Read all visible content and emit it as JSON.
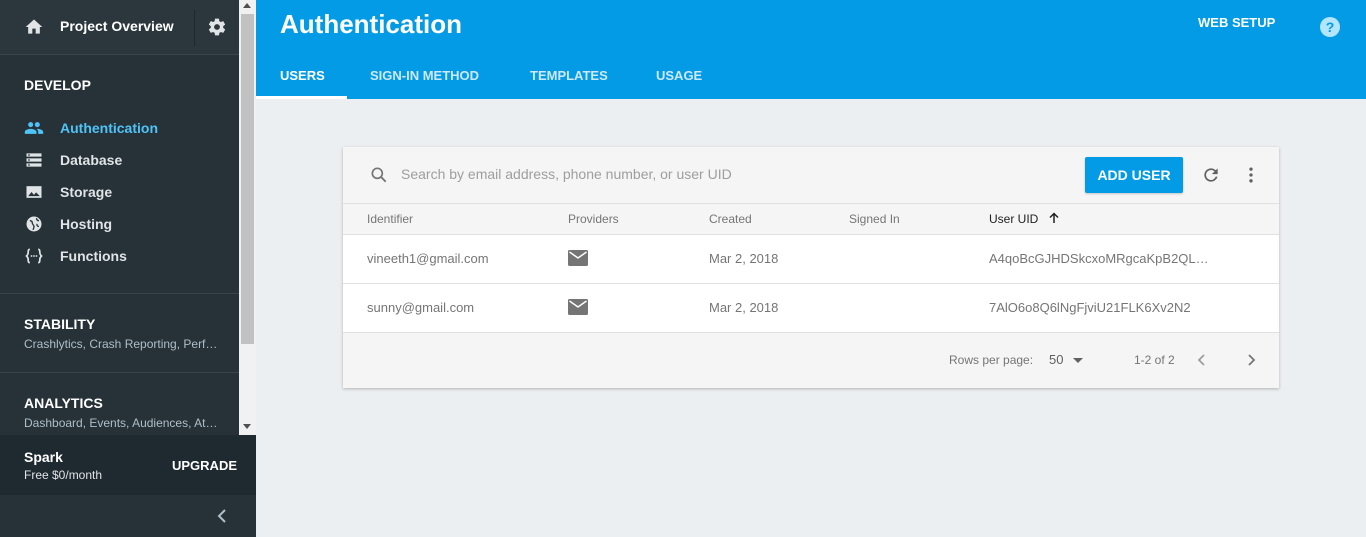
{
  "sidebar": {
    "project_title": "Project Overview",
    "develop": {
      "title": "DEVELOP",
      "items": [
        {
          "label": "Authentication",
          "icon": "people-icon",
          "active": true
        },
        {
          "label": "Database",
          "icon": "database-icon"
        },
        {
          "label": "Storage",
          "icon": "image-icon"
        },
        {
          "label": "Hosting",
          "icon": "globe-icon"
        },
        {
          "label": "Functions",
          "icon": "functions-icon"
        }
      ]
    },
    "stability": {
      "title": "STABILITY",
      "subtitle": "Crashlytics, Crash Reporting, Perf…"
    },
    "analytics": {
      "title": "ANALYTICS",
      "subtitle": "Dashboard, Events, Audiences, At…"
    },
    "plan": {
      "name": "Spark",
      "price": "Free $0/month",
      "upgrade_label": "UPGRADE"
    }
  },
  "header": {
    "title": "Authentication",
    "web_setup": "WEB SETUP",
    "help": "?",
    "tabs": [
      {
        "label": "USERS",
        "active": true
      },
      {
        "label": "SIGN-IN METHOD"
      },
      {
        "label": "TEMPLATES"
      },
      {
        "label": "USAGE"
      }
    ]
  },
  "users": {
    "search_placeholder": "Search by email address, phone number, or user UID",
    "add_user_label": "ADD USER",
    "columns": [
      "Identifier",
      "Providers",
      "Created",
      "Signed In",
      "User UID"
    ],
    "rows": [
      {
        "identifier": "vineeth1@gmail.com",
        "provider": "mail-icon",
        "created": "Mar 2, 2018",
        "signed_in": "",
        "uid": "A4qoBcGJHDSkcxoMRgcaKpB2QL…"
      },
      {
        "identifier": "sunny@gmail.com",
        "provider": "mail-icon",
        "created": "Mar 2, 2018",
        "signed_in": "",
        "uid": "7AlO6o8Q6lNgFjviU21FLK6Xv2N2"
      }
    ],
    "rows_per_page_label": "Rows per page:",
    "rows_per_page": "50",
    "range": "1-2 of 2"
  },
  "colors": {
    "accent": "#039be5",
    "sidebar": "#263238",
    "active_nav": "#4fc3f7"
  }
}
